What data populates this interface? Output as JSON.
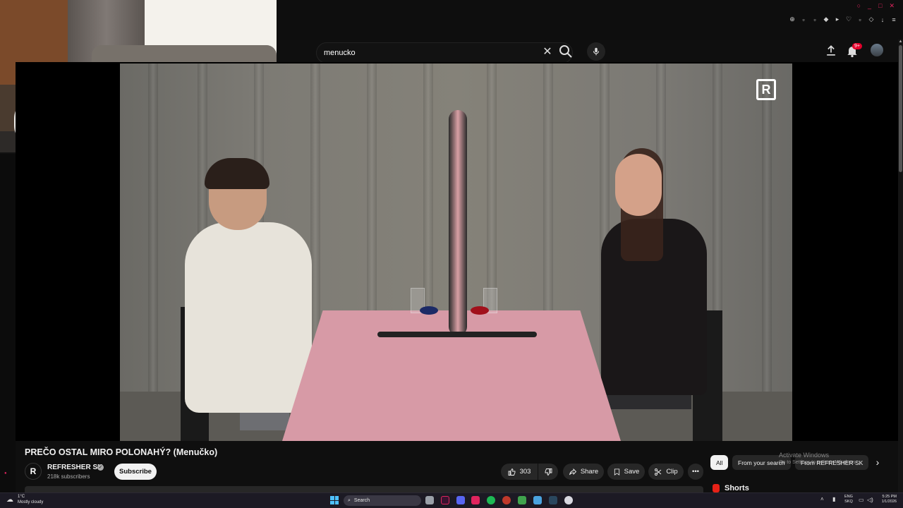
{
  "search": {
    "query": "menucko"
  },
  "header": {
    "notification_badge": "9+"
  },
  "video": {
    "title": "PREČO OSTAL MIRO POLONAHÝ? (Menučko)",
    "channel_name": "REFRESHER SK",
    "channel_logo_letter": "R",
    "subscribers": "218k subscribers",
    "subscribe_label": "Subscribe",
    "likes": "303",
    "share_label": "Share",
    "save_label": "Save",
    "clip_label": "Clip",
    "watermark_letter": "R"
  },
  "chips": [
    "All",
    "From your search",
    "From REFRESHER SK"
  ],
  "activate_windows": {
    "title": "Activate Windows",
    "subtitle": "Go to Settings to activate Windows."
  },
  "shorts": {
    "label": "Shorts"
  },
  "taskbar": {
    "weather_temp": "1°C",
    "weather_desc": "Mostly cloudy",
    "search_label": "Search",
    "lang_top": "ENG",
    "lang_bottom": "SKQ",
    "time": "5:25 PM",
    "date": "1/1/2026"
  },
  "colors": {
    "youtube_red": "#e62117",
    "background": "#0f0f0f",
    "pill": "#272727",
    "accent_pink": "#e0245e"
  },
  "icons": [
    "search-icon",
    "close-icon",
    "mic-icon",
    "upload-icon",
    "bell-icon",
    "like-icon",
    "dislike-icon",
    "share-icon",
    "save-icon",
    "clip-icon",
    "more-icon",
    "chevron-right-icon",
    "windows-start-icon",
    "weather-icon"
  ]
}
